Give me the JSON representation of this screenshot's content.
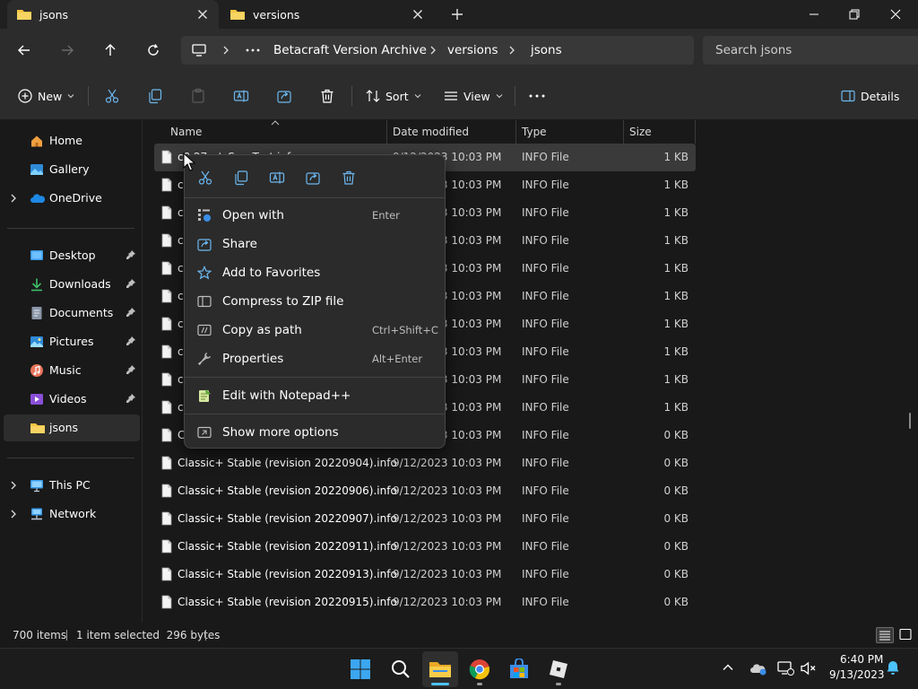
{
  "tabs": [
    {
      "label": "jsons",
      "active": true
    },
    {
      "label": "versions",
      "active": false
    }
  ],
  "breadcrumbs": [
    "Betacraft Version Archive",
    "versions",
    "jsons"
  ],
  "search": {
    "placeholder": "Search jsons"
  },
  "toolbar": {
    "new_label": "New",
    "sort_label": "Sort",
    "view_label": "View",
    "details_label": "Details"
  },
  "sidebar": {
    "items": [
      {
        "label": "Home",
        "icon": "home-icon"
      },
      {
        "label": "Gallery",
        "icon": "gallery-icon"
      },
      {
        "label": "OneDrive",
        "icon": "cloud-icon"
      },
      {
        "label": "Desktop",
        "icon": "desktop-icon"
      },
      {
        "label": "Downloads",
        "icon": "download-icon"
      },
      {
        "label": "Documents",
        "icon": "document-icon"
      },
      {
        "label": "Pictures",
        "icon": "picture-icon"
      },
      {
        "label": "Music",
        "icon": "music-icon"
      },
      {
        "label": "Videos",
        "icon": "video-icon"
      },
      {
        "label": "jsons",
        "icon": "folder-icon"
      },
      {
        "label": "This PC",
        "icon": "pc-icon"
      },
      {
        "label": "Network",
        "icon": "network-icon"
      }
    ]
  },
  "columns": {
    "name": "Name",
    "date": "Date modified",
    "type": "Type",
    "size": "Size"
  },
  "files": [
    {
      "name": "c0.27_st_SurvTest.info",
      "date": "9/12/2023 10:03 PM",
      "type": "INFO File",
      "size": "1 KB",
      "selected": true
    },
    {
      "name": "c",
      "date": "9/12/2023 10:03 PM",
      "type": "INFO File",
      "size": "1 KB"
    },
    {
      "name": "c",
      "date": "9/12/2023 10:03 PM",
      "type": "INFO File",
      "size": "1 KB"
    },
    {
      "name": "c",
      "date": "9/12/2023 10:03 PM",
      "type": "INFO File",
      "size": "1 KB"
    },
    {
      "name": "c",
      "date": "9/12/2023 10:03 PM",
      "type": "INFO File",
      "size": "1 KB"
    },
    {
      "name": "c",
      "date": "9/12/2023 10:03 PM",
      "type": "INFO File",
      "size": "1 KB"
    },
    {
      "name": "c",
      "date": "9/12/2023 10:03 PM",
      "type": "INFO File",
      "size": "1 KB"
    },
    {
      "name": "c",
      "date": "9/12/2023 10:03 PM",
      "type": "INFO File",
      "size": "1 KB"
    },
    {
      "name": "c",
      "date": "9/12/2023 10:03 PM",
      "type": "INFO File",
      "size": "1 KB"
    },
    {
      "name": "c",
      "date": "9/12/2023 10:03 PM",
      "type": "INFO File",
      "size": "1 KB"
    },
    {
      "name": "C",
      "date": "9/12/2023 10:03 PM",
      "type": "INFO File",
      "size": "0 KB"
    },
    {
      "name": "Classic+ Stable (revision 20220904).info",
      "date": "9/12/2023 10:03 PM",
      "type": "INFO File",
      "size": "0 KB"
    },
    {
      "name": "Classic+ Stable (revision 20220906).info",
      "date": "9/12/2023 10:03 PM",
      "type": "INFO File",
      "size": "0 KB"
    },
    {
      "name": "Classic+ Stable (revision 20220907).info",
      "date": "9/12/2023 10:03 PM",
      "type": "INFO File",
      "size": "0 KB"
    },
    {
      "name": "Classic+ Stable (revision 20220911).info",
      "date": "9/12/2023 10:03 PM",
      "type": "INFO File",
      "size": "0 KB"
    },
    {
      "name": "Classic+ Stable (revision 20220913).info",
      "date": "9/12/2023 10:03 PM",
      "type": "INFO File",
      "size": "0 KB"
    },
    {
      "name": "Classic+ Stable (revision 20220915).info",
      "date": "9/12/2023 10:03 PM",
      "type": "INFO File",
      "size": "0 KB"
    }
  ],
  "context_menu": {
    "quick_actions": [
      "cut-icon",
      "copy-icon",
      "rename-icon",
      "share-icon",
      "delete-icon"
    ],
    "items": [
      {
        "label": "Open with",
        "shortcut": "Enter",
        "icon": "open-with-icon"
      },
      {
        "label": "Share",
        "shortcut": "",
        "icon": "share-icon"
      },
      {
        "label": "Add to Favorites",
        "shortcut": "",
        "icon": "star-icon"
      },
      {
        "label": "Compress to ZIP file",
        "shortcut": "",
        "icon": "zip-icon"
      },
      {
        "label": "Copy as path",
        "shortcut": "Ctrl+Shift+C",
        "icon": "copy-path-icon"
      },
      {
        "label": "Properties",
        "shortcut": "Alt+Enter",
        "icon": "wrench-icon"
      },
      {
        "label": "Edit with Notepad++",
        "shortcut": "",
        "icon": "notepadpp-icon"
      },
      {
        "label": "Show more options",
        "shortcut": "",
        "icon": "more-options-icon"
      }
    ]
  },
  "status": {
    "count": "700 items",
    "selection": "1 item selected  296 bytes"
  },
  "clock": {
    "time": "6:40 PM",
    "date": "9/13/2023"
  },
  "colors": {
    "accent": "#4cc2ff",
    "folder": "#f5c542",
    "selection": "#3a3a3a",
    "menu": "#2b2b2b"
  }
}
